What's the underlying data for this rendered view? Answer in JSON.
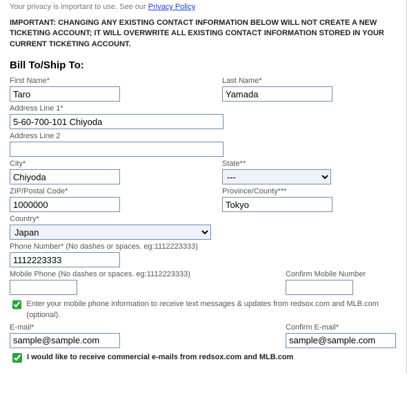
{
  "privacy": {
    "text_prefix": "Your privacy is important to use. See our ",
    "link_text": "Privacy Policy"
  },
  "warning_text": "IMPORTANT: CHANGING ANY EXISTING CONTACT INFORMATION BELOW WILL NOT CREATE A NEW TICKETING ACCOUNT; IT WILL OVERWRITE ALL EXISTING CONTACT INFORMATION STORED IN YOUR CURRENT TICKETING ACCOUNT.",
  "section_title": "Bill To/Ship To:",
  "labels": {
    "first_name": "First Name*",
    "last_name": "Last Name*",
    "address1": "Address Line 1*",
    "address2": "Address Line 2",
    "city": "City*",
    "state": "State**",
    "zip": "ZIP/Postal Code*",
    "province": "Province/County***",
    "country": "Country*",
    "phone": "Phone Number* (No dashes or spaces. eg:1112223333)",
    "mobile": "Mobile Phone (No dashes or spaces. eg:1112223333)",
    "confirm_mobile": "Confirm Mobile Number",
    "email": "E-mail*",
    "confirm_email": "Confirm E-mail*"
  },
  "values": {
    "first_name": "Taro",
    "last_name": "Yamada",
    "address1": "5-60-700-101 Chiyoda",
    "address2": "",
    "city": "Chiyoda",
    "state": "---",
    "zip": "1000000",
    "province": "Tokyo",
    "country": "Japan",
    "phone": "1112223333",
    "mobile": "",
    "confirm_mobile": "",
    "email": "sample@sample.com",
    "confirm_email": "sample@sample.com"
  },
  "checkboxes": {
    "mobile_opt_text": "Enter your mobile phone information to receive text messages & updates from redsox.com and MLB.com (optional).",
    "email_opt_text": "I would like to receive commercial e-mails from redsox.com and MLB.com"
  }
}
